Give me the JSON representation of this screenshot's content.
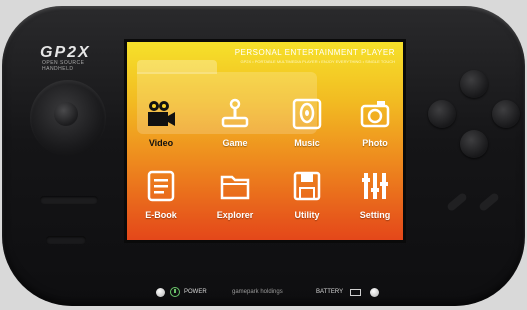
{
  "device": {
    "brand": "GP2X",
    "brand_sub": "OPEN SOURCE HANDHELD"
  },
  "screen": {
    "header": "PERSONAL ENTERTAINMENT PLAYER",
    "fine_print": "GP2X • PORTABLE MULTIMEDIA PLAYER • ENJOY EVERYTHING • SINGLE TOUCH"
  },
  "apps": [
    {
      "label": "Video",
      "icon": "video-camera-icon",
      "selected": true
    },
    {
      "label": "Game",
      "icon": "joystick-icon",
      "selected": false
    },
    {
      "label": "Music",
      "icon": "music-icon",
      "selected": false
    },
    {
      "label": "Photo",
      "icon": "camera-icon",
      "selected": false
    },
    {
      "label": "E-Book",
      "icon": "ebook-icon",
      "selected": false
    },
    {
      "label": "Explorer",
      "icon": "folder-icon",
      "selected": false
    },
    {
      "label": "Utility",
      "icon": "floppy-icon",
      "selected": false
    },
    {
      "label": "Setting",
      "icon": "tools-icon",
      "selected": false
    }
  ],
  "bottom_bar": {
    "power_label": "POWER",
    "company": "gamepark holdings",
    "battery_label": "BATTERY"
  },
  "colors": {
    "screen_top": "#f6e12a",
    "screen_bottom": "#e4471a",
    "body": "#151517"
  }
}
